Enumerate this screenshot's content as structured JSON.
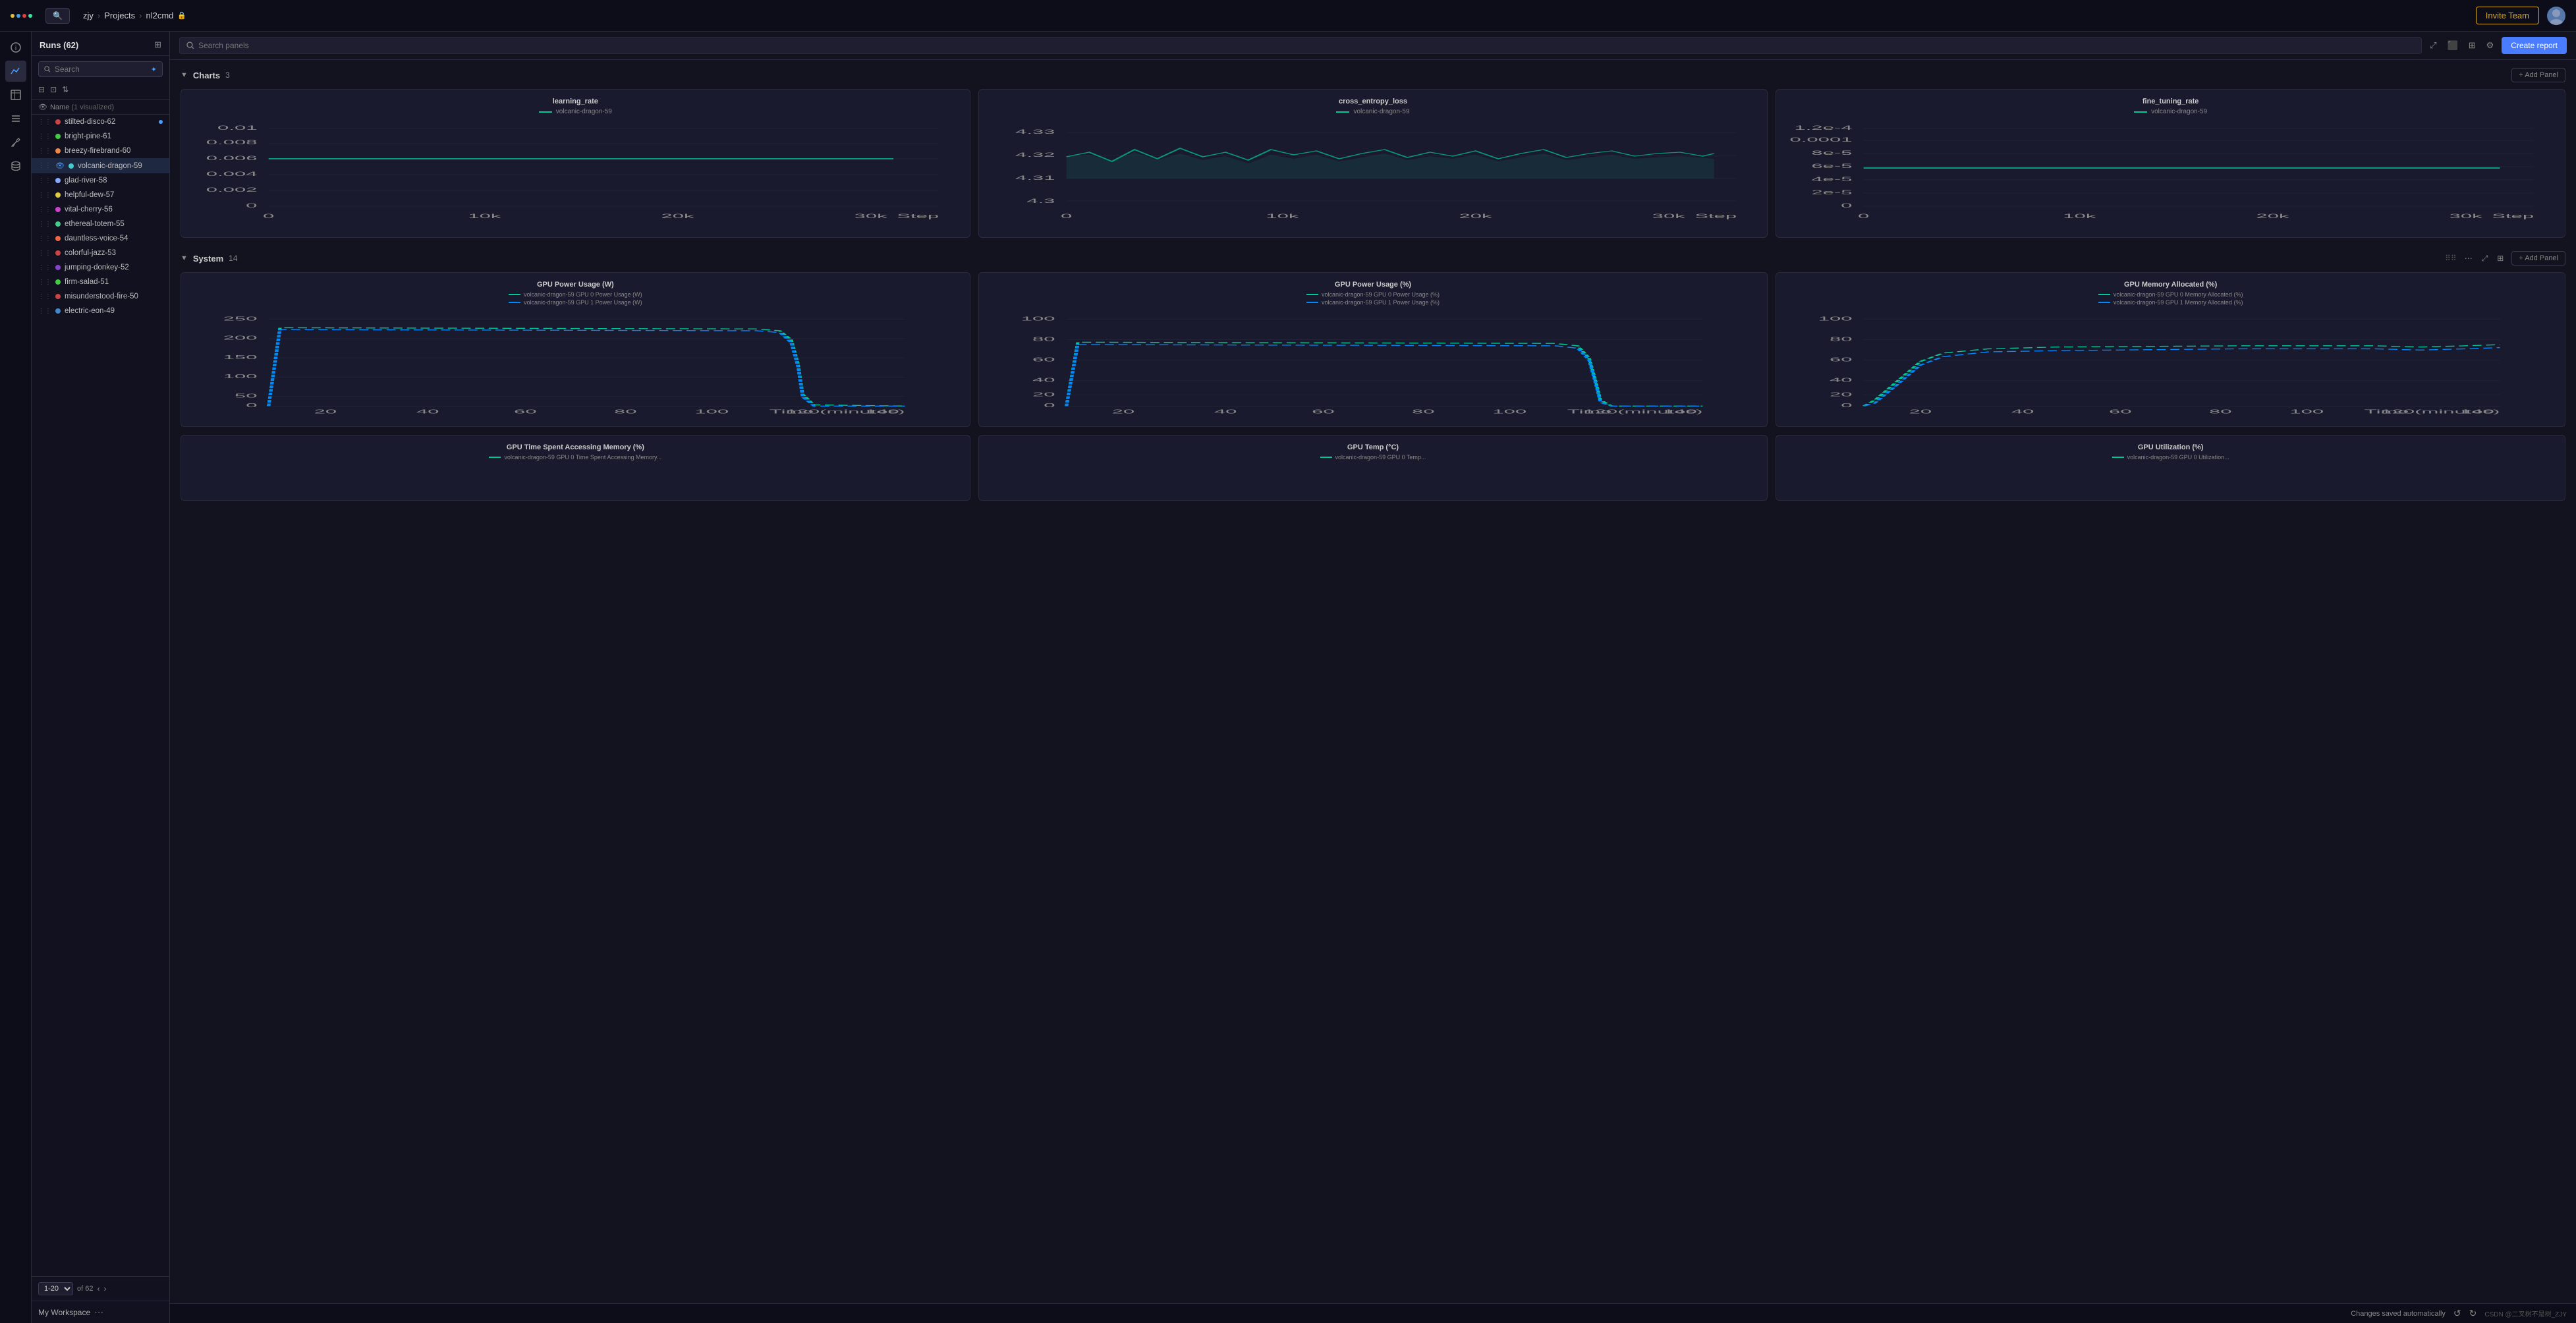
{
  "app": {
    "logo_dots": [
      "dot1",
      "dot2",
      "dot3",
      "dot4"
    ],
    "breadcrumb": {
      "user": "zjy",
      "projects_label": "Projects",
      "project_name": "nl2cmd",
      "lock_icon": "🔒"
    },
    "invite_button_label": "Invite Team",
    "search_placeholder": "Search"
  },
  "sidebar": {
    "icons": [
      {
        "name": "info-icon",
        "symbol": "ℹ",
        "active": false
      },
      {
        "name": "chart-icon",
        "symbol": "📈",
        "active": true
      },
      {
        "name": "table-icon",
        "symbol": "⊞",
        "active": false
      },
      {
        "name": "list-icon",
        "symbol": "☰",
        "active": false
      },
      {
        "name": "brush-icon",
        "symbol": "🖌",
        "active": false
      },
      {
        "name": "db-icon",
        "symbol": "⬡",
        "active": false
      }
    ]
  },
  "runs_panel": {
    "title": "Runs (62)",
    "search_placeholder": "Search",
    "name_column_label": "Name",
    "name_count_label": "(1 visualized)",
    "runs": [
      {
        "id": "stilted-disco-62",
        "color": "#cc4444",
        "active_dot": true
      },
      {
        "id": "bright-pine-61",
        "color": "#44cc44",
        "active_dot": false
      },
      {
        "id": "breezy-firebrand-60",
        "color": "#ee8844",
        "active_dot": false
      },
      {
        "id": "volcanic-dragon-59",
        "color": "#44cccc",
        "active_dot": false,
        "eye": true
      },
      {
        "id": "glad-river-58",
        "color": "#88aaff",
        "active_dot": false
      },
      {
        "id": "helpful-dew-57",
        "color": "#ddcc44",
        "active_dot": false
      },
      {
        "id": "vital-cherry-56",
        "color": "#cc44cc",
        "active_dot": false
      },
      {
        "id": "ethereal-totem-55",
        "color": "#44cc88",
        "active_dot": false
      },
      {
        "id": "dauntless-voice-54",
        "color": "#ee6644",
        "active_dot": false
      },
      {
        "id": "colorful-jazz-53",
        "color": "#cc4444",
        "active_dot": false
      },
      {
        "id": "jumping-donkey-52",
        "color": "#8844cc",
        "active_dot": false
      },
      {
        "id": "firm-salad-51",
        "color": "#44cc44",
        "active_dot": false
      },
      {
        "id": "misunderstood-fire-50",
        "color": "#cc4444",
        "active_dot": false
      },
      {
        "id": "electric-eon-49",
        "color": "#4488cc",
        "active_dot": false
      }
    ],
    "pagination": {
      "range_label": "1-20",
      "of_label": "of 62"
    },
    "workspace_label": "My Workspace"
  },
  "toolbar": {
    "search_panels_placeholder": "Search panels",
    "create_report_label": "Create report"
  },
  "charts_section": {
    "title": "Charts",
    "count": "3",
    "add_panel_label": "+ Add Panel",
    "charts": [
      {
        "id": "learning_rate",
        "title": "learning_rate",
        "legend_run": "volcanic-dragon-59",
        "legend_color": "#00c896",
        "y_labels": [
          "0.01",
          "0.008",
          "0.006",
          "0.004",
          "0.002",
          "0"
        ],
        "x_labels": [
          "0",
          "10k",
          "20k",
          "30k"
        ],
        "x_axis_label": "Step",
        "type": "flat_line"
      },
      {
        "id": "cross_entropy_loss",
        "title": "cross_entropy_loss",
        "legend_run": "volcanic-dragon-59",
        "legend_color": "#00c896",
        "y_labels": [
          "4.33",
          "4.32",
          "4.31",
          "4.3"
        ],
        "x_labels": [
          "0",
          "10k",
          "20k",
          "30k"
        ],
        "x_axis_label": "Step",
        "type": "noisy_flat"
      },
      {
        "id": "fine_tuning_rate",
        "title": "fine_tuning_rate",
        "legend_run": "volcanic-dragon-59",
        "legend_color": "#00c896",
        "y_labels": [
          "1.2e-4",
          "0.0001",
          "8e-5",
          "6e-5",
          "4e-5",
          "2e-5",
          "0"
        ],
        "x_labels": [
          "0",
          "10k",
          "20k",
          "30k"
        ],
        "x_axis_label": "Step",
        "type": "flat_line_high"
      }
    ]
  },
  "system_section": {
    "title": "System",
    "count": "14",
    "add_panel_label": "+ Add Panel",
    "charts": [
      {
        "id": "gpu_power_w",
        "title": "GPU Power Usage (W)",
        "legends": [
          {
            "run": "volcanic-dragon-59 GPU 0 Power Usage (W)",
            "color": "#00c896"
          },
          {
            "run": "volcanic-dragon-59 GPU 1 Power Usage (W)",
            "color": "#0088ff"
          }
        ],
        "y_labels": [
          "250",
          "200",
          "150",
          "100",
          "50",
          "0"
        ],
        "x_labels": [
          "20",
          "40",
          "60",
          "80",
          "100",
          "120",
          "140"
        ],
        "x_axis_label": "Time (minutes)",
        "type": "drop_end"
      },
      {
        "id": "gpu_power_pct",
        "title": "GPU Power Usage (%)",
        "legends": [
          {
            "run": "volcanic-dragon-59 GPU 0 Power Usage (%)",
            "color": "#00c896"
          },
          {
            "run": "volcanic-dragon-59 GPU 1 Power Usage (%)",
            "color": "#0088ff"
          }
        ],
        "y_labels": [
          "100",
          "80",
          "60",
          "40",
          "20",
          "0"
        ],
        "x_labels": [
          "20",
          "40",
          "60",
          "80",
          "100",
          "120",
          "140"
        ],
        "x_axis_label": "Time (minutes)",
        "type": "drop_end_pct"
      },
      {
        "id": "gpu_memory_alloc",
        "title": "GPU Memory Allocated (%)",
        "legends": [
          {
            "run": "volcanic-dragon-59 GPU 0 Memory Allocated (%)",
            "color": "#00c896"
          },
          {
            "run": "volcanic-dragon-59 GPU 1 Memory Allocated (%)",
            "color": "#0088ff"
          }
        ],
        "y_labels": [
          "100",
          "80",
          "60",
          "40",
          "20",
          "0"
        ],
        "x_labels": [
          "20",
          "40",
          "60",
          "80",
          "100",
          "120",
          "140"
        ],
        "x_axis_label": "Time (minutes)",
        "type": "ramp_flat"
      }
    ],
    "bottom_charts": [
      {
        "id": "gpu_time_mem",
        "title": "GPU Time Spent Accessing Memory (%)",
        "legends": [
          {
            "run": "volcanic-dragon-59 GPU 0 Time Spent...",
            "color": "#00c896"
          }
        ]
      },
      {
        "id": "gpu_temp",
        "title": "GPU Temp (°C)",
        "legends": [
          {
            "run": "volcanic-dragon-59 GPU 0 Temp...",
            "color": "#00c896"
          }
        ]
      },
      {
        "id": "gpu_utilization",
        "title": "GPU Utilization (%)",
        "legends": [
          {
            "run": "volcanic-dragon-59 GPU 0 Util...",
            "color": "#00c896"
          }
        ]
      }
    ]
  },
  "status_bar": {
    "saved_label": "Changes saved automatically",
    "watermark": "CSDN @二叉树不是树_ZJY"
  }
}
